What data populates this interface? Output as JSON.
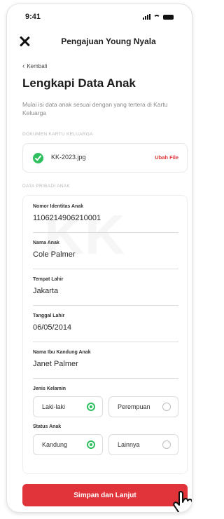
{
  "status_bar": {
    "time": "9:41"
  },
  "app_bar": {
    "title": "Pengajuan Young Nyala"
  },
  "back": {
    "label": "Kembali"
  },
  "page": {
    "title": "Lengkapi Data Anak",
    "description": "Mulai isi data anak sesuai dengan yang tertera di Kartu Keluarga"
  },
  "document_section": {
    "label": "DOKUMEN KARTU KELUARGA",
    "file_name": "KK-2023.jpg",
    "change_label": "Ubah File"
  },
  "personal_section": {
    "label": "DATA PRIBADI ANAK",
    "fields": [
      {
        "label": "Nomor Identitas Anak",
        "value": "1106214906210001"
      },
      {
        "label": "Nama Anak",
        "value": "Cole Palmer"
      },
      {
        "label": "Tempat Lahir",
        "value": "Jakarta"
      },
      {
        "label": "Tanggal Lahir",
        "value": "06/05/2014"
      },
      {
        "label": "Nama Ibu Kandung Anak",
        "value": "Janet Palmer"
      }
    ],
    "gender": {
      "label": "Jenis Kelamin",
      "options": [
        "Laki-laki",
        "Perempuan"
      ],
      "selected": "Laki-laki"
    },
    "child_status": {
      "label": "Status Anak",
      "options": [
        "Kandung",
        "Lainnya"
      ],
      "selected": "Kandung"
    }
  },
  "cta": {
    "label": "Simpan dan Lanjut"
  },
  "colors": {
    "accent": "#e0343a",
    "success": "#2fbf5f"
  },
  "icons": [
    "close-icon",
    "chevron-left-icon",
    "check-circle-icon",
    "radio-selected-icon",
    "radio-unselected-icon",
    "hand-pointer-icon"
  ]
}
